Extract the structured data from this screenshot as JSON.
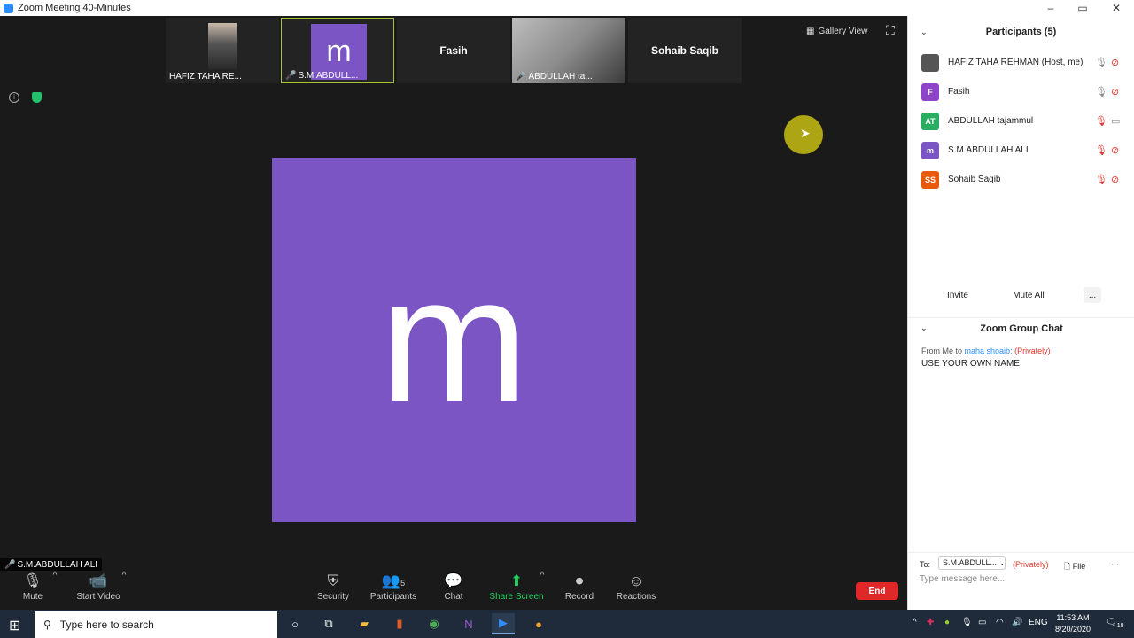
{
  "window": {
    "title": "Zoom Meeting 40-Minutes",
    "minimize": "–",
    "maximize": "▭",
    "close": "✕"
  },
  "gallery_strip": [
    {
      "name": "HAFIZ TAHA RE...",
      "type": "photo"
    },
    {
      "name": "S.M.ABDULL...",
      "type": "avatar",
      "initial": "m",
      "active": true
    },
    {
      "name": "Fasih",
      "type": "name"
    },
    {
      "name": "ABDULLAH ta...",
      "type": "camera"
    },
    {
      "name": "Sohaib Saqib",
      "type": "name"
    }
  ],
  "view": {
    "gallery_label": "Gallery View"
  },
  "main_video": {
    "initial": "m",
    "color": "#7b55c3",
    "speaker_tag": "S.M.ABDULLAH ALI"
  },
  "toolbar": {
    "mute": "Mute",
    "start_video": "Start Video",
    "security": "Security",
    "participants": "Participants",
    "participants_count": "5",
    "chat": "Chat",
    "share_screen": "Share Screen",
    "record": "Record",
    "reactions": "Reactions",
    "end": "End"
  },
  "participants_panel": {
    "title": "Participants (5)",
    "list": [
      {
        "name": "HAFIZ TAHA REHMAN (Host, me)",
        "initials": "",
        "color": "#555555",
        "mic_muted": false,
        "video_on": false
      },
      {
        "name": "Fasih",
        "initials": "F",
        "color": "#8e44c9",
        "mic_muted": false,
        "video_on": false
      },
      {
        "name": "ABDULLAH tajammul",
        "initials": "AT",
        "color": "#27ae60",
        "mic_muted": true,
        "video_on": true
      },
      {
        "name": "S.M.ABDULLAH ALI",
        "initials": "m",
        "color": "#7b55c3",
        "mic_muted": true,
        "video_on": false
      },
      {
        "name": "Sohaib Saqib",
        "initials": "SS",
        "color": "#e8590c",
        "mic_muted": true,
        "video_on": false
      }
    ],
    "invite": "Invite",
    "mute_all": "Mute All",
    "more": "..."
  },
  "chat": {
    "title": "Zoom Group Chat",
    "from_prefix": "From Me to",
    "to_name": "maha shoaib:",
    "private_label": "(Privately)",
    "message": "USE YOUR OWN NAME",
    "to_label": "To:",
    "recipient": "S.M.ABDULL...",
    "recipient_private": "(Privately)",
    "file": "File",
    "placeholder": "Type message here..."
  },
  "taskbar": {
    "search_placeholder": "Type here to search",
    "language": "ENG",
    "time": "11:53 AM",
    "date": "8/20/2020",
    "notifications": "18"
  }
}
